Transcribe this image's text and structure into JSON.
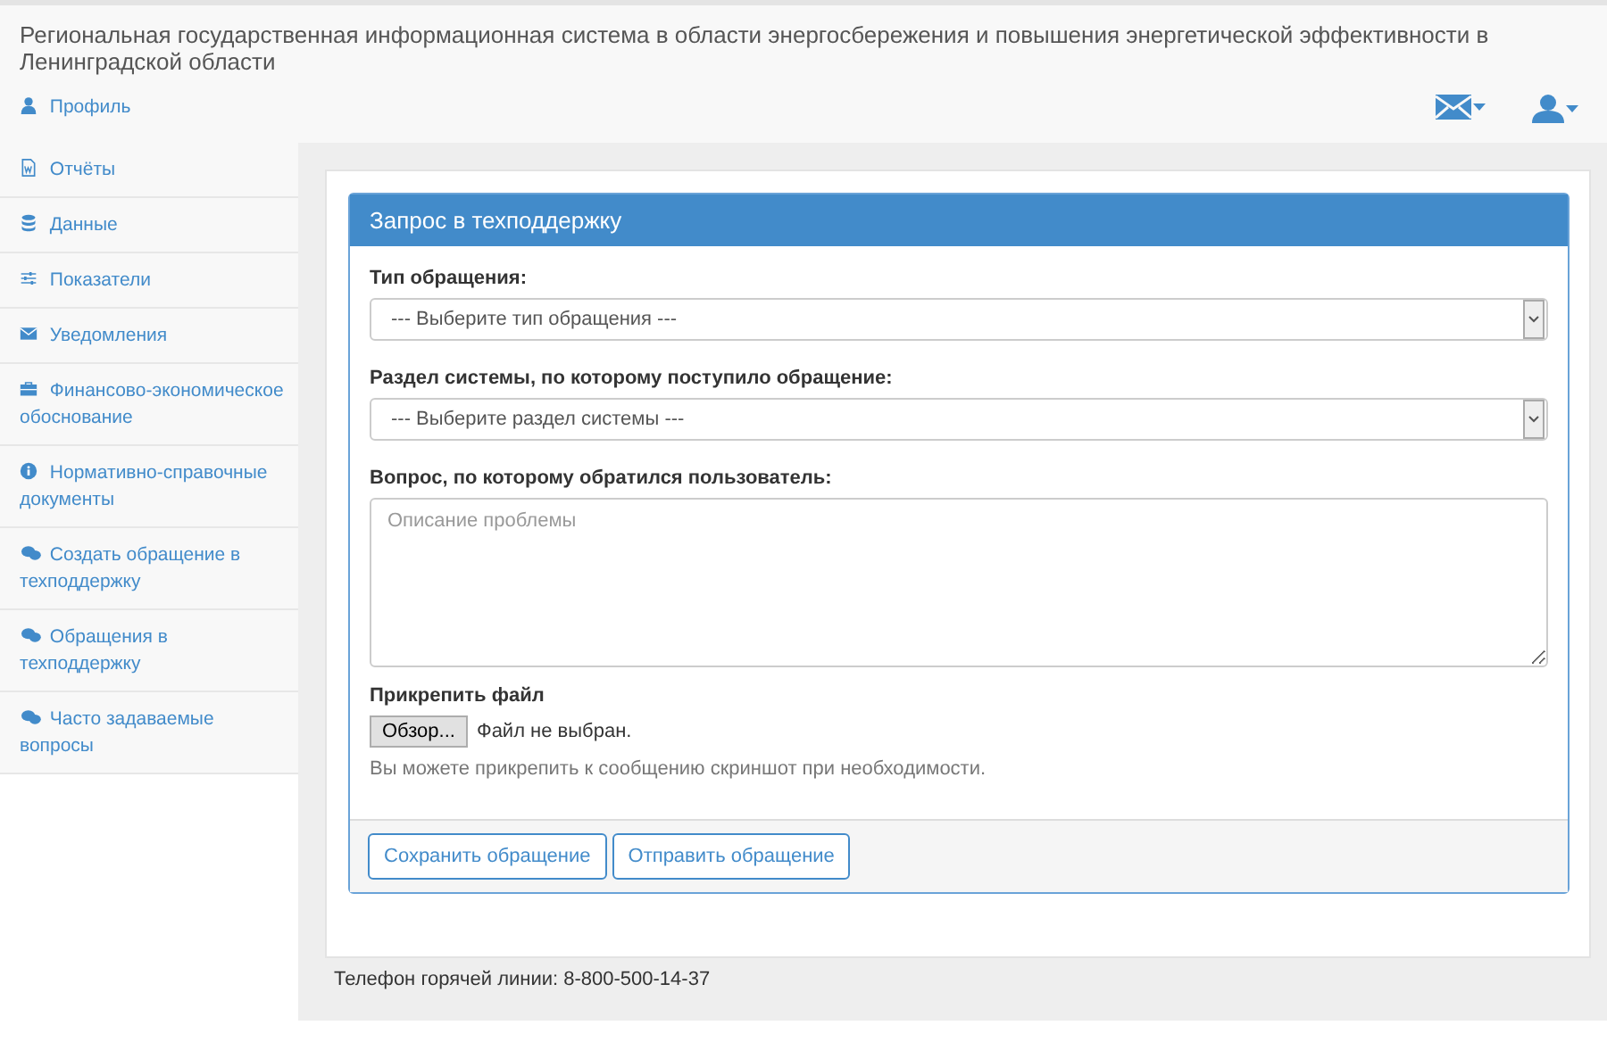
{
  "header": {
    "title": "Региональная государственная информационная система в области энергосбережения и повышения энергетической эффективности в Ленинградской области"
  },
  "sidebar": {
    "items": [
      {
        "label": "Профиль"
      },
      {
        "label": "Отчёты"
      },
      {
        "label": "Данные"
      },
      {
        "label": "Показатели"
      },
      {
        "label": "Уведомления"
      },
      {
        "label": "Финансово-экономическое обоснование"
      },
      {
        "label": "Нормативно-справочные документы"
      },
      {
        "label": "Создать обращение в техподдержку"
      },
      {
        "label": "Обращения в техподдержку"
      },
      {
        "label": "Часто задаваемые вопросы"
      }
    ]
  },
  "panel": {
    "title": "Запрос в техподдержку",
    "type_label": "Тип обращения:",
    "type_select": "--- Выберите тип обращения ---",
    "section_label": "Раздел системы, по которому поступило обращение:",
    "section_select": "--- Выберите раздел системы ---",
    "question_label": "Вопрос, по которому обратился пользователь:",
    "question_placeholder": "Описание проблемы",
    "attach_label": "Прикрепить файл",
    "browse_button": "Обзор...",
    "file_status": "Файл не выбран.",
    "attach_hint": "Вы можете прикрепить к сообщению скриншот при необходимости.",
    "buttons": [
      "Сохранить обращение",
      "Отправить обращение"
    ]
  },
  "footer": {
    "hotline": "Телефон горячей линии: 8-800-500-14-37"
  }
}
